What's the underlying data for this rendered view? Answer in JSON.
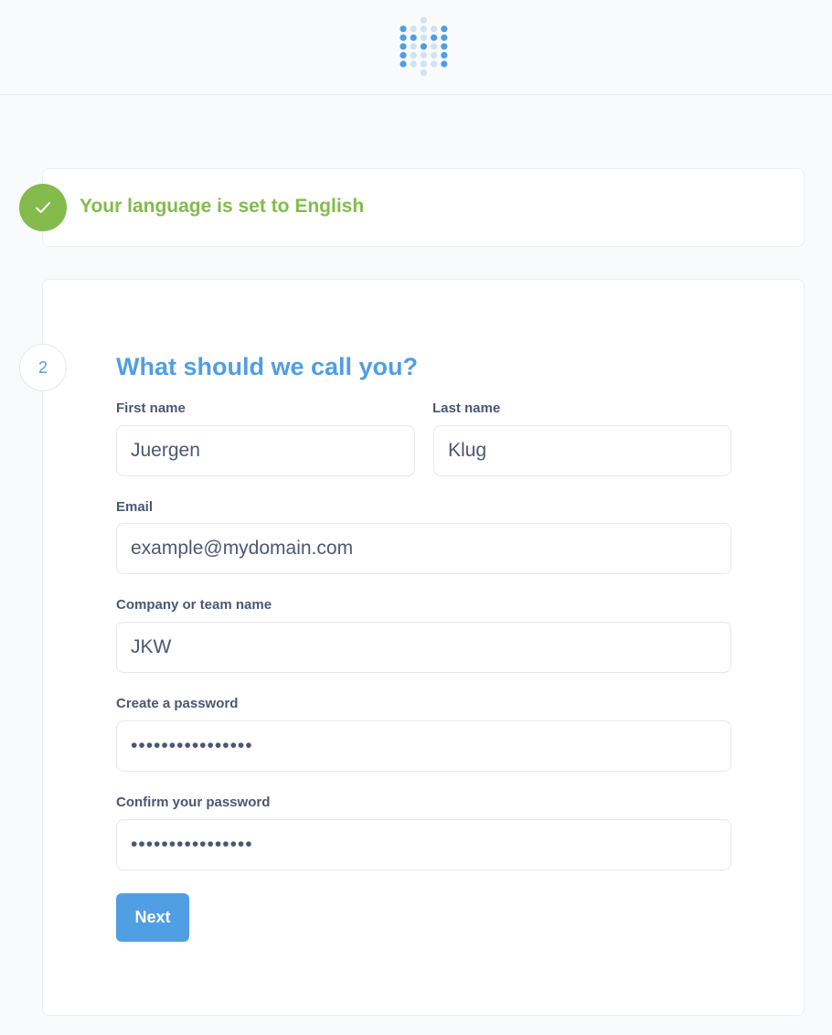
{
  "colors": {
    "brand": "#509ee3",
    "success": "#84bb4c",
    "text": "#4c5773",
    "border": "#e6e8ec",
    "background": "#f9fafb"
  },
  "header": {
    "logo_icon": "dot-grid-logo-icon"
  },
  "step1": {
    "status_icon": "checkmark-icon",
    "message": "Your language is set to English"
  },
  "step2": {
    "number": "2",
    "title": "What should we call you?",
    "fields": {
      "first_name": {
        "label": "First name",
        "value": "Juergen"
      },
      "last_name": {
        "label": "Last name",
        "value": "Klug"
      },
      "email": {
        "label": "Email",
        "value": "example@mydomain.com"
      },
      "company": {
        "label": "Company or team name",
        "value": "JKW"
      },
      "password": {
        "label": "Create a password",
        "value": "••••••••••••••••"
      },
      "confirm_password": {
        "label": "Confirm your password",
        "value": "••••••••••••••••"
      }
    },
    "next_label": "Next"
  }
}
